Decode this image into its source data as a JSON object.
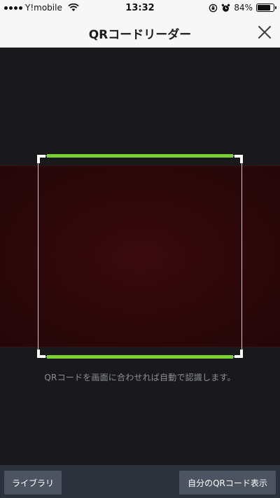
{
  "status_bar": {
    "carrier": "Y!mobile",
    "time": "13:32",
    "battery": "84%"
  },
  "header": {
    "title": "QRコードリーダー"
  },
  "scanner": {
    "instruction": "QRコードを画面に合わせれば自動で認識します。",
    "accent_color": "#7bd033"
  },
  "toolbar": {
    "library_label": "ライブラリ",
    "my_qr_label": "自分のQRコード表示"
  }
}
